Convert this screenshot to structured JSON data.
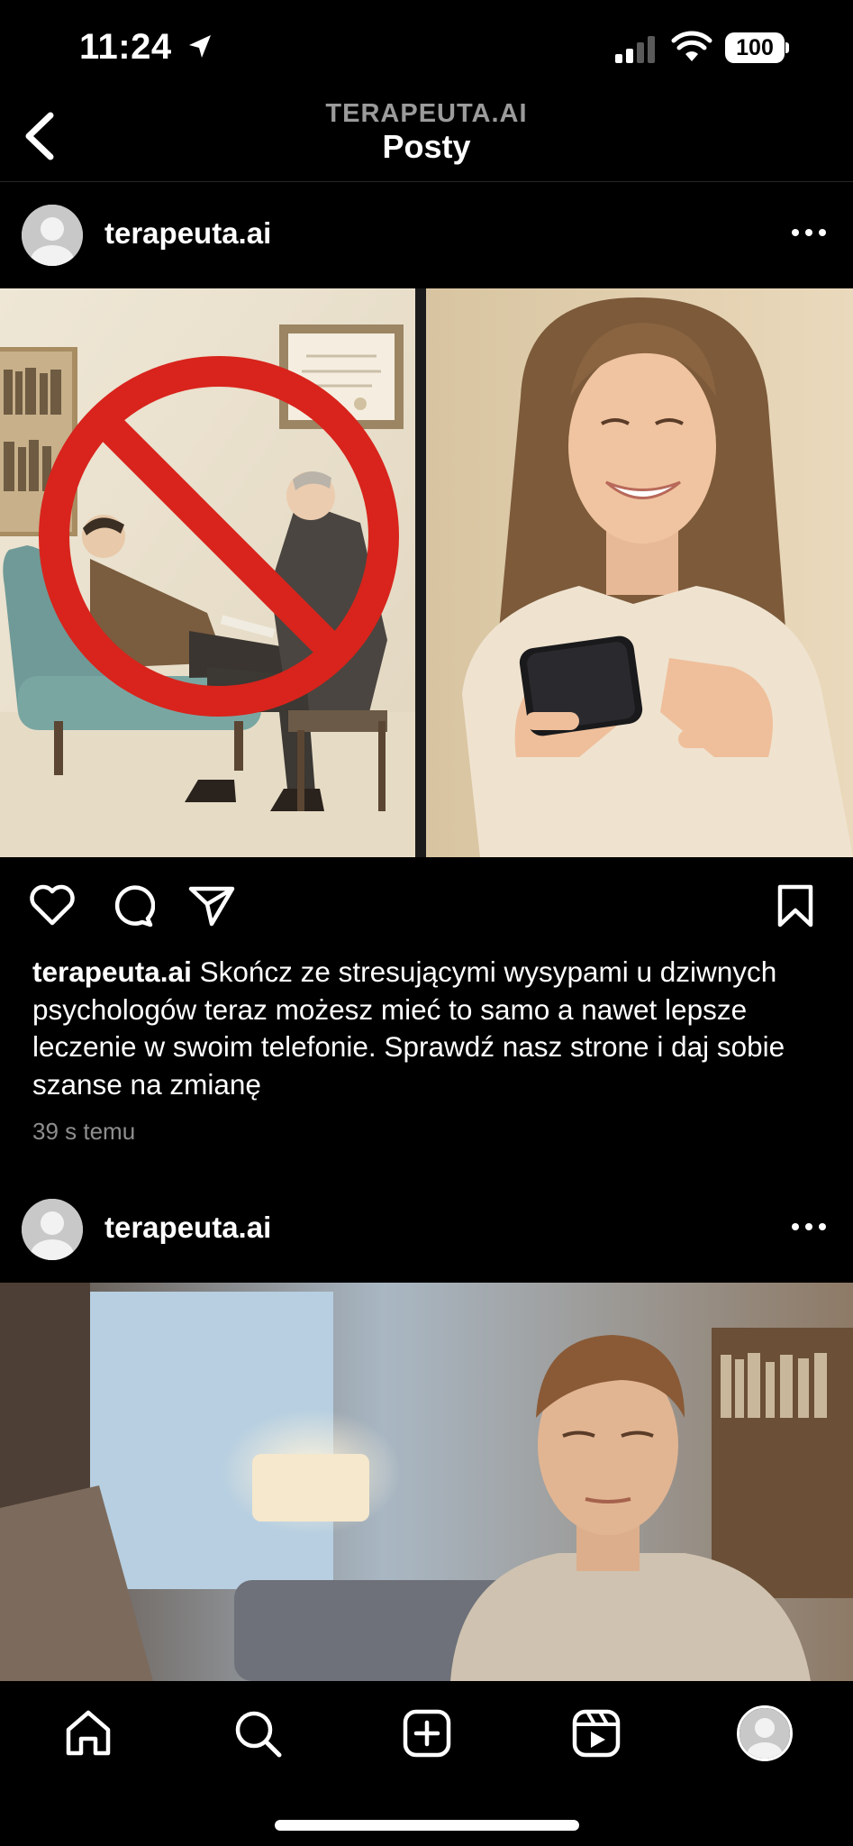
{
  "status_bar": {
    "time": "11:24",
    "battery": "100"
  },
  "header": {
    "subtitle": "TERAPEUTA.AI",
    "title": "Posty"
  },
  "posts": [
    {
      "username": "terapeuta.ai",
      "caption_user": "terapeuta.ai",
      "caption": "Skończ ze stresującymi wysypami u dziwnych psychologów teraz możesz mieć to samo a nawet lepsze leczenie w swoim telefonie. Sprawdź nasz strone i daj sobie szanse na zmianę",
      "timestamp": "39 s temu"
    },
    {
      "username": "terapeuta.ai"
    }
  ],
  "icons": {
    "back": "chevron-left-icon",
    "location": "location-arrow-icon",
    "signal": "signal-bars-icon",
    "wifi": "wifi-icon",
    "more": "more-horizontal-icon",
    "like": "heart-icon",
    "comment": "comment-icon",
    "share": "paper-plane-icon",
    "save": "bookmark-icon",
    "home": "home-icon",
    "search": "search-icon",
    "create": "plus-square-icon",
    "reels": "reels-icon",
    "profile": "profile-avatar-icon"
  },
  "colors": {
    "background": "#000000",
    "text": "#ffffff",
    "muted": "#8e8e8e",
    "prohibition_red": "#d8241c"
  }
}
